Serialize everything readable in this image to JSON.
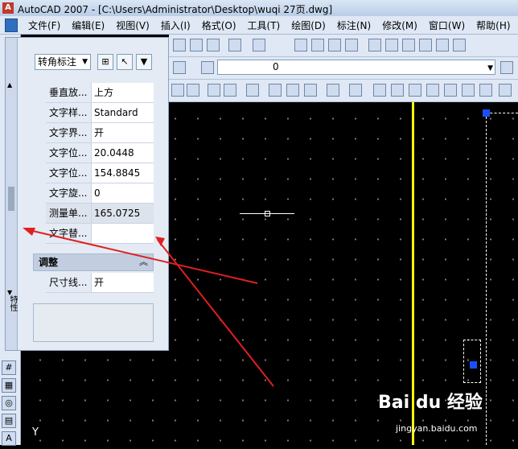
{
  "window": {
    "title": "AutoCAD 2007 - [C:\\Users\\Administrator\\Desktop\\wuqi 27页.dwg]",
    "app_icon": "A"
  },
  "menu": [
    "文件(F)",
    "编辑(E)",
    "视图(V)",
    "插入(I)",
    "格式(O)",
    "工具(T)",
    "绘图(D)",
    "标注(N)",
    "修改(M)",
    "窗口(W)",
    "帮助(H)"
  ],
  "layer": {
    "current": "0"
  },
  "properties": {
    "object_type": "转角标注",
    "text_rows": [
      {
        "key": "垂直放...",
        "value": "上方"
      },
      {
        "key": "文字样...",
        "value": "Standard"
      },
      {
        "key": "文字界...",
        "value": "开"
      },
      {
        "key": "文字位...",
        "value": "20.0448"
      },
      {
        "key": "文字位...",
        "value": "154.8845"
      },
      {
        "key": "文字旋...",
        "value": "0"
      },
      {
        "key": "测量单...",
        "value": "165.0725"
      },
      {
        "key": "文字替...",
        "value": ""
      }
    ],
    "section_title": "调整",
    "adjust_rows": [
      {
        "key": "尺寸线...",
        "value": "开"
      }
    ],
    "side_label": "特性"
  },
  "canvas": {
    "ucs_label": "Y"
  },
  "watermark": {
    "brand": "Bai du 经验",
    "url": "jingyan.baidu.com"
  },
  "colors": {
    "accent_arrow": "#e0201e",
    "construction_line": "#ffff00",
    "grip": "#1a4fff"
  }
}
